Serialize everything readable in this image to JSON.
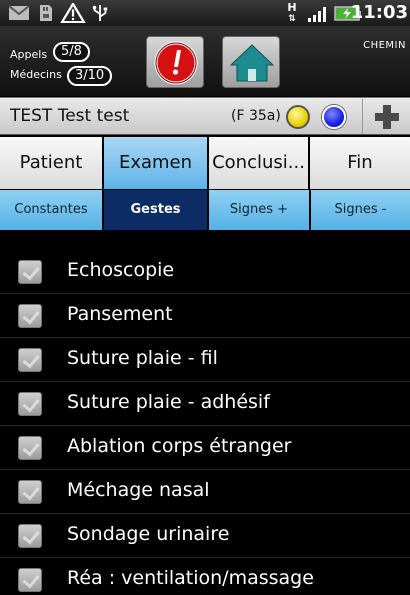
{
  "status_bar": {
    "time": "11:03",
    "icons": [
      "email-icon",
      "sd-card-icon",
      "warning-icon",
      "usb-icon",
      "data-arrows-icon",
      "signal-icon",
      "battery-icon"
    ],
    "data_letter": "H"
  },
  "header": {
    "appels_label": "Appels",
    "appels_value": "5/8",
    "medecins_label": "Médecins",
    "medecins_value": "3/10",
    "chemin_label": "CHEMIN"
  },
  "patient": {
    "name": "TEST Test test",
    "info": "(F 35a)"
  },
  "tabs": [
    {
      "label": "Patient",
      "active": false
    },
    {
      "label": "Examen",
      "active": true
    },
    {
      "label": "Conclusi...",
      "active": false
    },
    {
      "label": "Fin",
      "active": false
    }
  ],
  "subtabs": [
    {
      "label": "Constantes",
      "active": false
    },
    {
      "label": "Gestes",
      "active": true
    },
    {
      "label": "Signes +",
      "active": false
    },
    {
      "label": "Signes -",
      "active": false
    }
  ],
  "items": [
    {
      "label": "Echoscopie"
    },
    {
      "label": "Pansement"
    },
    {
      "label": "Suture plaie - fil"
    },
    {
      "label": "Suture plaie - adhésif"
    },
    {
      "label": "Ablation corps étranger"
    },
    {
      "label": "Méchage nasal"
    },
    {
      "label": "Sondage urinaire"
    },
    {
      "label": "Réa : ventilation/massage"
    }
  ],
  "colors": {
    "tab_active": "#5db3ea",
    "subtab_active": "#0c2c66",
    "alert_red": "#d41010",
    "home_teal": "#1d8c90"
  }
}
